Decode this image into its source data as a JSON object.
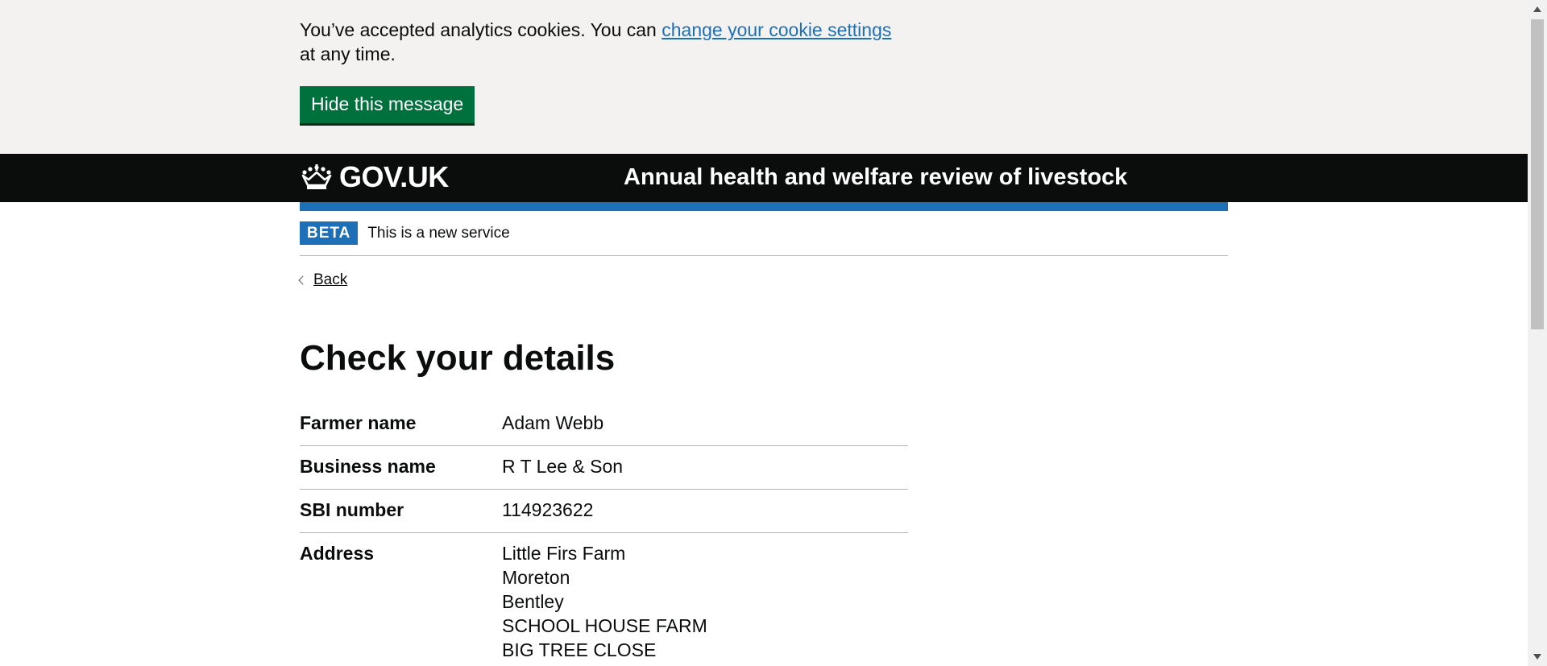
{
  "cookie_banner": {
    "text_before": "You’ve accepted analytics cookies. You can ",
    "link": "change your cookie settings",
    "text_after": " at any time.",
    "hide_button": "Hide this message"
  },
  "header": {
    "logo": "GOV.UK",
    "service_name": "Annual health and welfare review of livestock"
  },
  "phase_banner": {
    "tag": "BETA",
    "text": "This is a new service"
  },
  "back_link": "Back",
  "page_title": "Check your details",
  "details": [
    {
      "key": "Farmer name",
      "value": "Adam Webb"
    },
    {
      "key": "Business name",
      "value": "R T Lee & Son"
    },
    {
      "key": "SBI number",
      "value": "114923622"
    },
    {
      "key": "Address",
      "lines": [
        "Little Firs Farm",
        "Moreton",
        "Bentley",
        "SCHOOL HOUSE FARM",
        "BIG TREE CLOSE"
      ]
    }
  ],
  "colors": {
    "link": "#1d70b8",
    "button": "#00703c",
    "header": "#0b0c0c",
    "brand_bar": "#1d70b8",
    "banner_bg": "#f3f2f1"
  },
  "icons": [
    "crown-icon",
    "chevron-left-icon",
    "scroll-up-icon",
    "scroll-down-icon"
  ]
}
